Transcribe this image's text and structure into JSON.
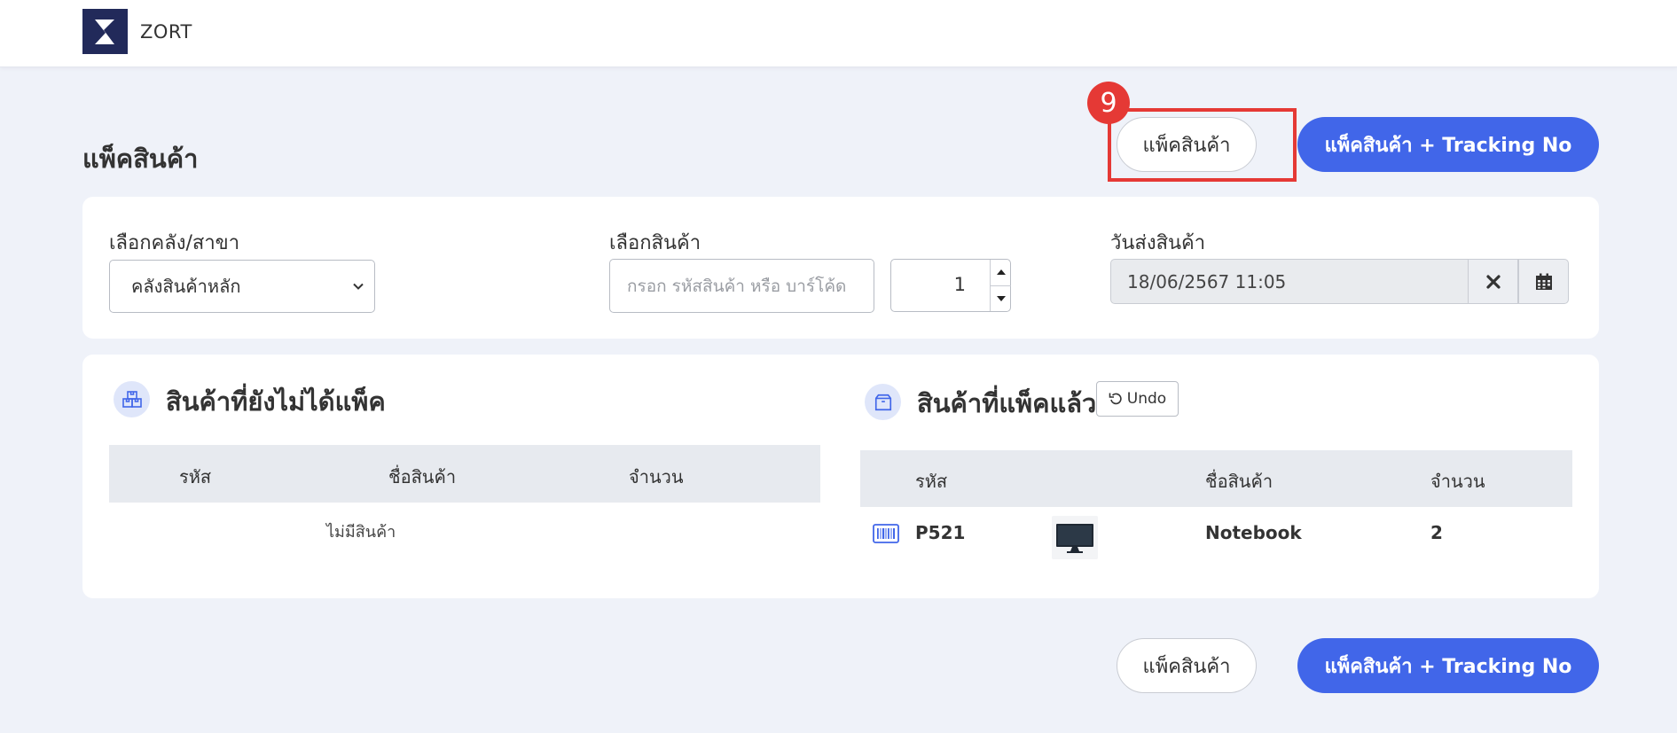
{
  "app": {
    "brand": "ZORT"
  },
  "page": {
    "title": "แพ็คสินค้า"
  },
  "actions": {
    "pack_label": "แพ็คสินค้า",
    "pack_tracking_label": "แพ็คสินค้า + Tracking No"
  },
  "annotation": {
    "step": "9"
  },
  "filters": {
    "warehouse_label": "เลือกคลัง/สาขา",
    "warehouse_value": "คลังสินค้าหลัก",
    "product_label": "เลือกสินค้า",
    "product_placeholder": "กรอก รหัสสินค้า หรือ บาร์โค้ด",
    "quantity": "1",
    "ship_date_label": "วันส่งสินค้า",
    "ship_date_value": "18/06/2567 11:05"
  },
  "unpacked": {
    "title": "สินค้าที่ยังไม่ได้แพ็ค",
    "columns": [
      "รหัส",
      "ชื่อสินค้า",
      "จำนวน"
    ],
    "empty": "ไม่มีสินค้า"
  },
  "packed": {
    "title": "สินค้าที่แพ็คแล้ว",
    "undo_label": "Undo",
    "columns": [
      "รหัส",
      "ชื่อสินค้า",
      "จำนวน"
    ],
    "rows": [
      {
        "code": "P521",
        "name": "Notebook",
        "qty": "2"
      }
    ]
  }
}
